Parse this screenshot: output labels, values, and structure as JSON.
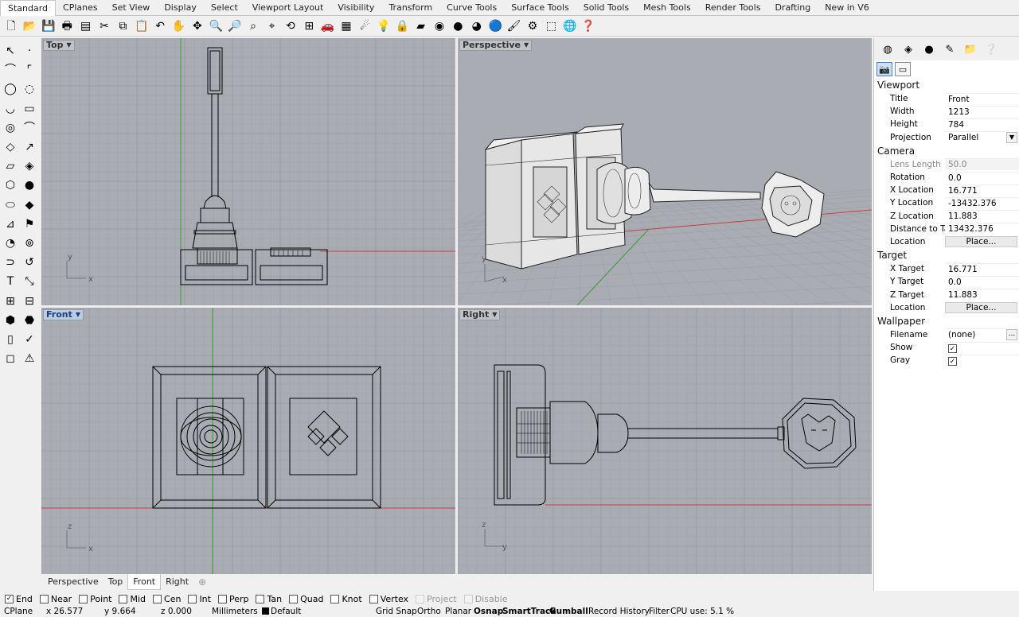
{
  "ribbon_tabs": [
    "Standard",
    "CPlanes",
    "Set View",
    "Display",
    "Select",
    "Viewport Layout",
    "Visibility",
    "Transform",
    "Curve Tools",
    "Surface Tools",
    "Solid Tools",
    "Mesh Tools",
    "Render Tools",
    "Drafting",
    "New in V6"
  ],
  "toolbar_icons": [
    "new-icon",
    "open-icon",
    "save-icon",
    "print-icon",
    "import-icon",
    "cut-icon",
    "copy-icon",
    "paste-icon",
    "undo-icon",
    "pan-icon",
    "rotate-view-icon",
    "zoom-icon",
    "zoom-window-icon",
    "zoom-extents-icon",
    "zoom-selected-icon",
    "rotate-camera-icon",
    "four-viewports-icon",
    "car-icon",
    "grid-icon",
    "point-light-icon",
    "bulb-icon",
    "lock-icon",
    "render-preview-icon",
    "color-wheel-icon",
    "shaded-sphere-icon",
    "render-sphere-icon",
    "blue-sphere-icon",
    "paintbrush-icon",
    "settings-gear-icon",
    "selection-icon",
    "globe-icon",
    "help-icon"
  ],
  "viewports": {
    "top": "Top",
    "perspective": "Perspective",
    "front": "Front",
    "right": "Right"
  },
  "axes": {
    "x": "x",
    "y": "y",
    "z": "z"
  },
  "viewport_tabs": [
    "Perspective",
    "Top",
    "Front",
    "Right"
  ],
  "panel": {
    "tab_icons": [
      "color-icon",
      "material-icon",
      "render-icon",
      "light-icon",
      "folder-icon",
      "help-icon"
    ],
    "viewport": {
      "header": "Viewport",
      "rows": [
        {
          "label": "Title",
          "value": "Front"
        },
        {
          "label": "Width",
          "value": "1213"
        },
        {
          "label": "Height",
          "value": "784"
        },
        {
          "label": "Projection",
          "value": "Parallel"
        }
      ]
    },
    "camera": {
      "header": "Camera",
      "rows": [
        {
          "label": "Lens Length",
          "value": "50.0"
        },
        {
          "label": "Rotation",
          "value": "0.0"
        },
        {
          "label": "X Location",
          "value": "16.771"
        },
        {
          "label": "Y Location",
          "value": "-13432.376"
        },
        {
          "label": "Z Location",
          "value": "11.883"
        },
        {
          "label": "Distance to Ta...",
          "value": "13432.376"
        },
        {
          "label": "Location",
          "value": "Place..."
        }
      ]
    },
    "target": {
      "header": "Target",
      "rows": [
        {
          "label": "X Target",
          "value": "16.771"
        },
        {
          "label": "Y Target",
          "value": "0.0"
        },
        {
          "label": "Z Target",
          "value": "11.883"
        },
        {
          "label": "Location",
          "value": "Place..."
        }
      ]
    },
    "wallpaper": {
      "header": "Wallpaper",
      "rows": [
        {
          "label": "Filename",
          "value": "(none)"
        },
        {
          "label": "Show",
          "value": "✓"
        },
        {
          "label": "Gray",
          "value": "✓"
        }
      ]
    }
  },
  "osnaps": [
    {
      "label": "End",
      "checked": true
    },
    {
      "label": "Near",
      "checked": false
    },
    {
      "label": "Point",
      "checked": false
    },
    {
      "label": "Mid",
      "checked": false
    },
    {
      "label": "Cen",
      "checked": false
    },
    {
      "label": "Int",
      "checked": false
    },
    {
      "label": "Perp",
      "checked": false
    },
    {
      "label": "Tan",
      "checked": false
    },
    {
      "label": "Quad",
      "checked": false
    },
    {
      "label": "Knot",
      "checked": false
    },
    {
      "label": "Vertex",
      "checked": false
    },
    {
      "label": "Project",
      "checked": false,
      "disabled": true
    },
    {
      "label": "Disable",
      "checked": false,
      "disabled": true
    }
  ],
  "status": {
    "cplane": "CPlane",
    "x": "x 26.577",
    "y": "y 9.664",
    "z": "z 0.000",
    "units": "Millimeters",
    "layer": "Default",
    "grid_snap": "Grid Snap",
    "ortho": "Ortho",
    "planar": "Planar",
    "osnap": "Osnap",
    "smarttrack": "SmartTrack",
    "gumball": "Gumball",
    "record_history": "Record History",
    "filter": "Filter",
    "cpu": "CPU use: 5.1 %"
  },
  "colors": {
    "viewport_bg": "#a9adb3",
    "grid": "#9ea2a8",
    "grid_major": "#8e9298",
    "x_axis": "#c84040",
    "y_axis": "#3a9a3a",
    "wire": "#000000"
  }
}
